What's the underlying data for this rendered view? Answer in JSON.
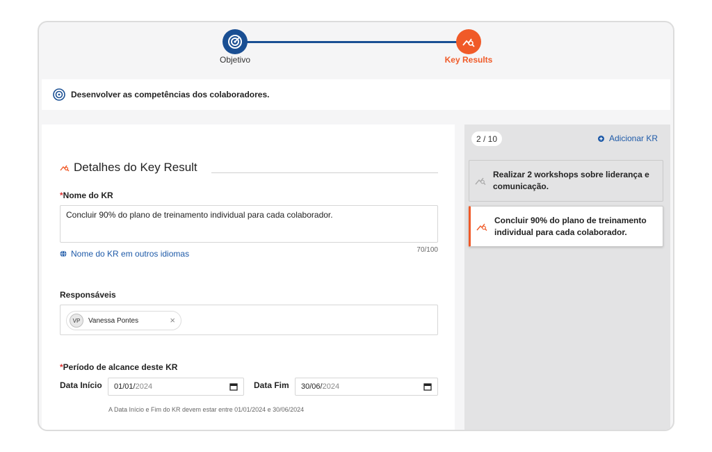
{
  "stepper": {
    "steps": [
      {
        "label": "Objetivo",
        "icon": "target-icon",
        "state": "done"
      },
      {
        "label": "Key Results",
        "icon": "key-result-icon",
        "state": "active"
      }
    ]
  },
  "objective": {
    "text": "Desenvolver as competências dos colaboradores.",
    "icon": "target-icon"
  },
  "form": {
    "section_title": "Detalhes do Key Result",
    "kr_name": {
      "required_mark": "*",
      "label": "Nome do KR",
      "value": "Concluir 90% do plano de treinamento individual para cada colaborador.",
      "counter": "70/100",
      "languages_link": "Nome do KR em outros idiomas"
    },
    "responsaveis": {
      "label": "Responsáveis",
      "people": [
        {
          "initials": "VP",
          "name": "Vanessa Pontes"
        }
      ]
    },
    "period": {
      "required_mark": "*",
      "label": "Período de alcance deste KR",
      "start_label": "Data Início",
      "start_day_month": "01/01/",
      "start_year": "2024",
      "end_label": "Data Fim",
      "end_day_month": "30/06/",
      "end_year": "2024",
      "hint": "A Data Início e Fim do KR devem estar entre 01/01/2024 e 30/06/2024"
    }
  },
  "kr_list": {
    "count": "2 / 10",
    "add_label": "Adicionar KR",
    "items": [
      {
        "text": "Realizar 2 workshops sobre liderança e comunicação.",
        "selected": false
      },
      {
        "text": "Concluir 90% do plano de treinamento individual para cada colaborador.",
        "selected": true
      }
    ]
  },
  "colors": {
    "primary_blue": "#1a4f93",
    "accent_orange": "#f05a28",
    "link_blue": "#1e5aa8"
  }
}
